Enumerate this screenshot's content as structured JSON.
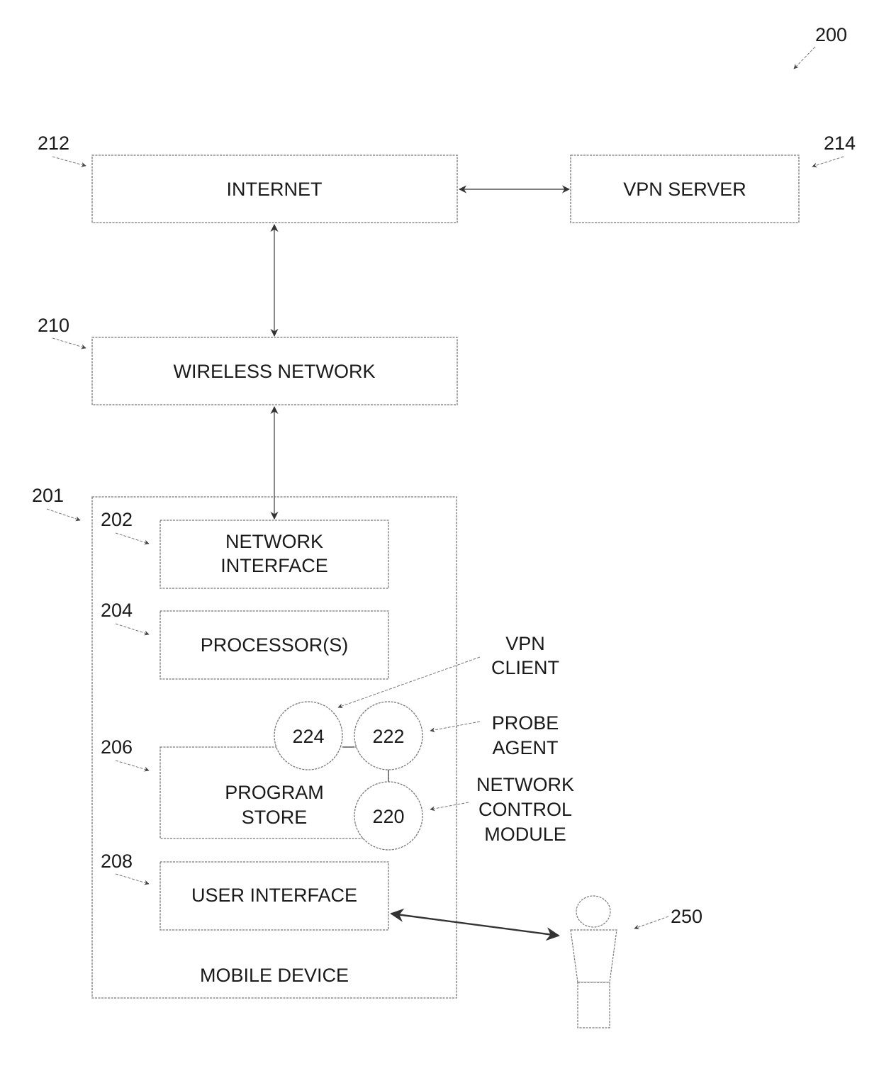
{
  "figure": {
    "ref": "200",
    "blocks": {
      "internet": {
        "ref": "212",
        "label": "INTERNET"
      },
      "vpn_server": {
        "ref": "214",
        "label": "VPN SERVER"
      },
      "wireless_network": {
        "ref": "210",
        "label": "WIRELESS NETWORK"
      },
      "mobile_device": {
        "ref": "201",
        "label": "MOBILE DEVICE"
      },
      "network_interface": {
        "ref": "202",
        "label_lines": [
          "NETWORK",
          "INTERFACE"
        ]
      },
      "processors": {
        "ref": "204",
        "label": "PROCESSOR(S)"
      },
      "program_store": {
        "ref": "206",
        "label_lines": [
          "PROGRAM",
          "STORE"
        ]
      },
      "user_interface": {
        "ref": "208",
        "label": "USER INTERFACE"
      }
    },
    "modules": {
      "vpn_client": {
        "ref": "224",
        "caption_lines": [
          "VPN",
          "CLIENT"
        ]
      },
      "probe_agent": {
        "ref": "222",
        "caption_lines": [
          "PROBE",
          "AGENT"
        ]
      },
      "network_control_module": {
        "ref": "220",
        "caption_lines": [
          "NETWORK",
          "CONTROL",
          "MODULE"
        ]
      }
    },
    "user": {
      "ref": "250"
    }
  }
}
